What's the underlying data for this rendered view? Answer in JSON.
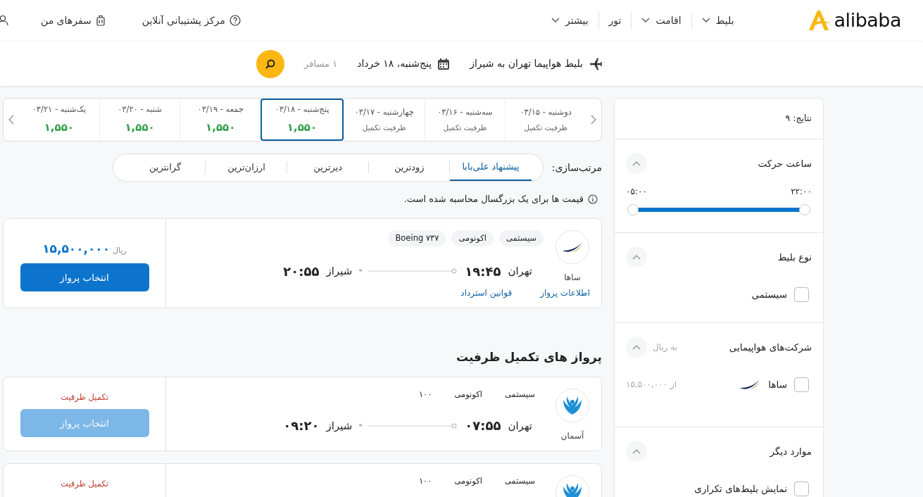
{
  "header": {
    "logo": "alibaba",
    "nav": [
      {
        "label": "بلیط",
        "dropdown": true
      },
      {
        "label": "اقامت",
        "dropdown": true
      },
      {
        "label": "تور",
        "dropdown": false
      },
      {
        "label": "بیشتر",
        "dropdown": true
      }
    ],
    "support": "مرکز پشتیبانی آنلاین",
    "my_trips": "سفرهای من"
  },
  "search_summary": {
    "route": "بلیط هواپیما تهران به شیراز",
    "date": "پنج‌شنبه، ۱۸ خرداد",
    "passengers": "۱ مسافر"
  },
  "sidebar": {
    "results": "نتایج: ۹",
    "sections": [
      {
        "kind": "range",
        "title": "ساعت حرکت",
        "expanded": true,
        "max_label": "۲۲:۰۰",
        "min_label": "۰۵:۰۰",
        "thumbs": [
          {
            "level": 0
          },
          {
            "level": 1
          }
        ]
      },
      {
        "kind": "checklist",
        "title": "نوع بلیط",
        "expanded": true,
        "options": [
          {
            "label": "سیستمی",
            "checked": false
          }
        ]
      },
      {
        "kind": "airlines",
        "title": "شرکت‌های هواپیمایی",
        "note": "به ریال",
        "expanded": true,
        "options": [
          {
            "label": "ساها",
            "checked": false,
            "price": "از ۱۵,۵۰۰,۰۰۰"
          }
        ]
      },
      {
        "kind": "checklist",
        "title": "موارد دیگر",
        "expanded": true,
        "options": [
          {
            "label": "نمایش بلیط‌های تکراری",
            "checked": false
          }
        ]
      }
    ]
  },
  "dates": [
    {
      "label": "دوشنبه - ۰۳/۱۵",
      "kind": "full",
      "text": "ظرفیت تکمیل",
      "selected": false
    },
    {
      "label": "سه‌شنبه - ۰۳/۱۶",
      "kind": "full",
      "text": "ظرفیت تکمیل",
      "selected": false
    },
    {
      "label": "چهارشنبه - ۰۳/۱۷",
      "kind": "full",
      "text": "ظرفیت تکمیل",
      "selected": false
    },
    {
      "label": "پنج‌شنبه - ۰۳/۱۸",
      "kind": "price",
      "text": "۱,۵۵۰",
      "selected": true
    },
    {
      "label": "جمعه - ۰۳/۱۹",
      "kind": "price",
      "text": "۱,۵۵۰",
      "selected": false
    },
    {
      "label": "شنبه - ۰۳/۲۰",
      "kind": "price",
      "text": "۱,۵۵۰",
      "selected": false
    },
    {
      "label": "یک‌شنبه - ۰۳/۲۱",
      "kind": "price",
      "text": "۱,۵۵۰",
      "selected": false
    }
  ],
  "sort": {
    "label": "مرتب‌سازی:",
    "options": [
      {
        "label": "پیشنهاد علی‌بابا",
        "selected": true
      },
      {
        "label": "زودترین",
        "selected": false
      },
      {
        "label": "دیرترین",
        "selected": false
      },
      {
        "label": "ارزان‌ترین",
        "selected": false
      },
      {
        "label": "گرانترین",
        "selected": false
      }
    ]
  },
  "price_note": "قیمت ها برای یک بزرگسال محاسبه شده است.",
  "flights": [
    {
      "kind": "available",
      "airline": "ساها",
      "tags": [
        "سیستمی",
        "اکونومی",
        "Boeing ۷۳۷"
      ],
      "origin": "تهران",
      "departure": "۱۹:۴۵",
      "destination": "شیراز",
      "arrival": "۲۰:۵۵",
      "links": [
        "اطلاعات پرواز",
        "قوانین استرداد"
      ],
      "price": "۱۵,۵۰۰,۰۰۰",
      "currency": "ریال",
      "button": "انتخاب پرواز",
      "disabled": false
    }
  ],
  "full_section": {
    "title": "پرواز های تکمیل ظرفیت",
    "flights": [
      {
        "kind": "full",
        "airline": "آسمان",
        "tags": [
          "سیستمی",
          "اکونومی",
          "۱۰۰"
        ],
        "origin": "تهران",
        "departure": "۰۷:۵۵",
        "destination": "شیراز",
        "arrival": "۰۹:۲۰",
        "status": "تکمیل ظرفیت",
        "button": "انتخاب پرواز",
        "disabled": true
      },
      {
        "kind": "full",
        "tags": [
          "سیستمی",
          "اکونومی",
          "۱۰۰"
        ],
        "status": "تکمیل ظرفیت"
      }
    ]
  }
}
